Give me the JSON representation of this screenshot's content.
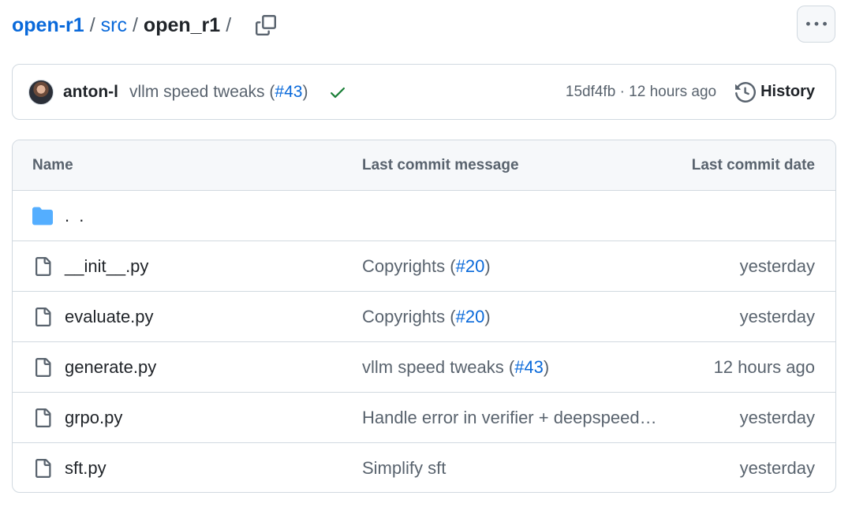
{
  "breadcrumb": {
    "repo": "open-r1",
    "folder": "src",
    "current": "open_r1",
    "separator": "/"
  },
  "icons": {
    "copy": "copy-icon",
    "more": "kebab-horizontal-icon",
    "check": "check-icon",
    "history": "history-icon",
    "folder": "folder-icon",
    "file": "file-icon"
  },
  "colors": {
    "link": "#0969da",
    "success": "#1a7f37",
    "folder": "#54aeff",
    "muted": "#59636e",
    "border": "#d1d9e0"
  },
  "commit": {
    "author": "anton-l",
    "message_prefix": "vllm speed tweaks (",
    "pr": "#43",
    "message_suffix": ")",
    "sha": "15df4fb",
    "separator": "·",
    "time": "12 hours ago",
    "history_label": "History"
  },
  "table": {
    "headers": {
      "name": "Name",
      "message": "Last commit message",
      "date": "Last commit date"
    },
    "parent_label": ". .",
    "rows": [
      {
        "name": "__init__.py",
        "msg_text": "Copyrights (",
        "msg_pr": "#20",
        "msg_end": ")",
        "date": "yesterday"
      },
      {
        "name": "evaluate.py",
        "msg_text": "Copyrights (",
        "msg_pr": "#20",
        "msg_end": ")",
        "date": "yesterday"
      },
      {
        "name": "generate.py",
        "msg_text": "vllm speed tweaks (",
        "msg_pr": "#43",
        "msg_end": ")",
        "date": "12 hours ago"
      },
      {
        "name": "grpo.py",
        "msg_text": "Handle error in verifier + deepspeed…",
        "msg_pr": "",
        "msg_end": "",
        "date": "yesterday"
      },
      {
        "name": "sft.py",
        "msg_text": "Simplify sft",
        "msg_pr": "",
        "msg_end": "",
        "date": "yesterday"
      }
    ]
  }
}
